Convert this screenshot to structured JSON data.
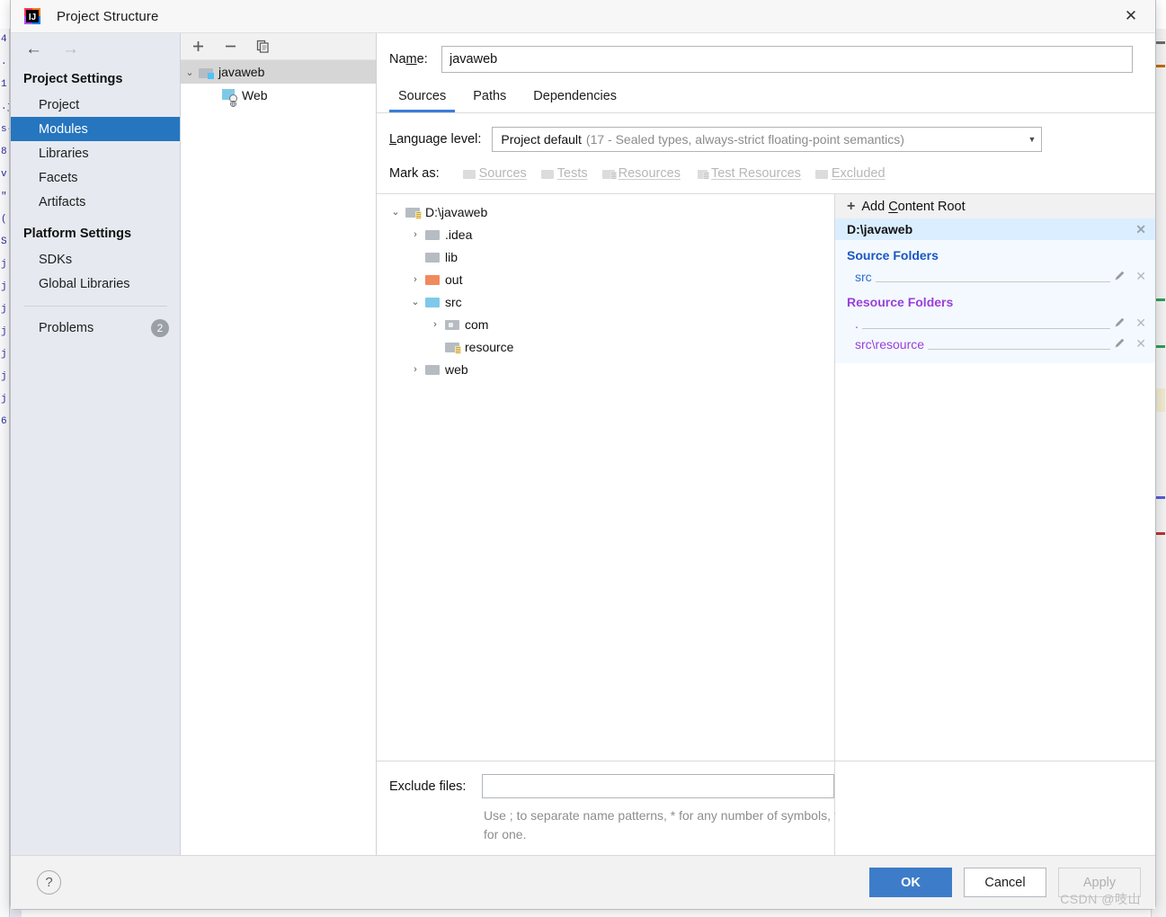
{
  "window": {
    "title": "Project Structure",
    "app_icon": "intellij-idea-icon",
    "close_icon": "close-icon"
  },
  "nav": {
    "back_icon": "arrow-left-icon",
    "forward_icon": "arrow-right-icon"
  },
  "sidebar": {
    "groups": [
      {
        "title": "Project Settings",
        "items": [
          {
            "label": "Project",
            "selected": false
          },
          {
            "label": "Modules",
            "selected": true
          },
          {
            "label": "Libraries",
            "selected": false
          },
          {
            "label": "Facets",
            "selected": false
          },
          {
            "label": "Artifacts",
            "selected": false
          }
        ]
      },
      {
        "title": "Platform Settings",
        "items": [
          {
            "label": "SDKs",
            "selected": false
          },
          {
            "label": "Global Libraries",
            "selected": false
          }
        ]
      }
    ],
    "problems": {
      "label": "Problems",
      "count": "2"
    }
  },
  "modules": {
    "toolbar": [
      {
        "name": "add-module-button",
        "glyph": "+"
      },
      {
        "name": "remove-module-button",
        "glyph": "−"
      },
      {
        "name": "copy-module-button",
        "glyph": "❐"
      }
    ],
    "tree": [
      {
        "label": "javaweb",
        "icon": "module-folder-icon",
        "expanded": true,
        "depth": 0,
        "selected": true,
        "chevron": "⌄"
      },
      {
        "label": "Web",
        "icon": "web-facet-icon",
        "expanded": false,
        "depth": 1,
        "selected": false,
        "chevron": ""
      }
    ]
  },
  "main": {
    "name_label": "Name:",
    "name_value": "javaweb",
    "tabs": [
      {
        "label": "Sources",
        "active": true
      },
      {
        "label": "Paths",
        "active": false
      },
      {
        "label": "Dependencies",
        "active": false
      }
    ],
    "language_level": {
      "label": "Language level:",
      "value": "Project default",
      "hint": "(17 - Sealed types, always-strict floating-point semantics)",
      "caret_icon": "chevron-down-icon"
    },
    "mark_as": {
      "label": "Mark as:",
      "options": [
        {
          "label": "Sources",
          "icon": "folder-sources-icon"
        },
        {
          "label": "Tests",
          "icon": "folder-tests-icon"
        },
        {
          "label": "Resources",
          "icon": "folder-resources-icon"
        },
        {
          "label": "Test Resources",
          "icon": "folder-test-resources-icon"
        },
        {
          "label": "Excluded",
          "icon": "folder-excluded-icon"
        }
      ]
    },
    "file_tree": [
      {
        "label": "D:\\javaweb",
        "depth": 0,
        "chevron": "⌄",
        "icon": "folder-content-root-icon"
      },
      {
        "label": ".idea",
        "depth": 1,
        "chevron": "›",
        "icon": "folder-grey-icon"
      },
      {
        "label": "lib",
        "depth": 1,
        "chevron": "",
        "icon": "folder-grey-icon"
      },
      {
        "label": "out",
        "depth": 1,
        "chevron": "›",
        "icon": "folder-excluded-orange-icon"
      },
      {
        "label": "src",
        "depth": 1,
        "chevron": "⌄",
        "icon": "folder-source-blue-icon"
      },
      {
        "label": "com",
        "depth": 2,
        "chevron": "›",
        "icon": "folder-package-icon"
      },
      {
        "label": "resource",
        "depth": 2,
        "chevron": "",
        "icon": "folder-resource-icon"
      },
      {
        "label": "web",
        "depth": 1,
        "chevron": "›",
        "icon": "folder-grey-icon"
      }
    ],
    "content_roots": {
      "add_label": "Add Content Root",
      "add_icon": "plus-icon",
      "root_path": "D:\\javaweb",
      "root_remove_icon": "close-icon",
      "sections": [
        {
          "title": "Source Folders",
          "kind": "src",
          "entries": [
            {
              "path": "src",
              "edit_icon": "pencil-icon",
              "remove_icon": "close-icon"
            }
          ]
        },
        {
          "title": "Resource Folders",
          "kind": "res",
          "entries": [
            {
              "path": ".",
              "edit_icon": "pencil-icon",
              "remove_icon": "close-icon"
            },
            {
              "path": "src\\resource",
              "edit_icon": "pencil-icon",
              "remove_icon": "close-icon"
            }
          ]
        }
      ]
    },
    "exclude": {
      "label": "Exclude files:",
      "value": "",
      "placeholder": "",
      "hint": "Use ; to separate name patterns, * for any number of symbols, ? for one."
    }
  },
  "footer": {
    "help_icon": "question-mark-icon",
    "ok_label": "OK",
    "cancel_label": "Cancel",
    "apply_label": "Apply",
    "watermark": "CSDN @吱山"
  },
  "colors": {
    "accent_selection": "#2675bf",
    "tab_underline": "#3b7dd8",
    "source_folder": "#2a6fd6",
    "resource_folder": "#9b3fd8",
    "primary_button": "#3d7cc9",
    "root_header_bg": "#dbeeff"
  },
  "background_gutter": [
    "4.",
    ".",
    "1",
    ".j",
    "s-",
    "8",
    "",
    "v",
    "\"",
    "(",
    "S",
    "j",
    "j",
    "j",
    "j",
    "j",
    "j",
    "j",
    "",
    "",
    "6"
  ]
}
